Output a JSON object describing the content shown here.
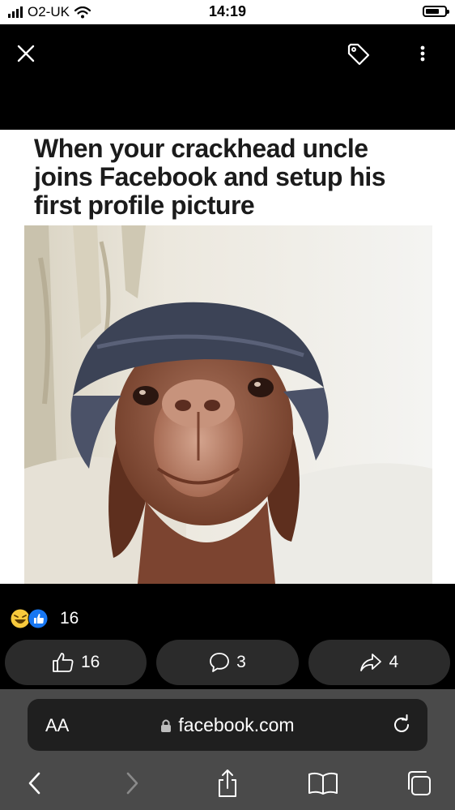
{
  "status_bar": {
    "carrier": "O2-UK",
    "time": "14:19"
  },
  "top_bar": {
    "close_icon": "close-icon",
    "tag_icon": "tag-icon",
    "more_icon": "more-vertical-icon"
  },
  "post": {
    "caption": "When your crackhead uncle joins Facebook and setup his first profile picture",
    "reaction_count": "16"
  },
  "actions": {
    "like_count": "16",
    "comment_count": "3",
    "share_count": "4"
  },
  "browser": {
    "text_size_label": "AA",
    "url": "facebook.com"
  },
  "colors": {
    "pill_bg": "#2b2b2b",
    "toolbar_bg": "#4a4a4a",
    "like_blue": "#1877f2",
    "haha_yellow": "#f7c93c"
  }
}
